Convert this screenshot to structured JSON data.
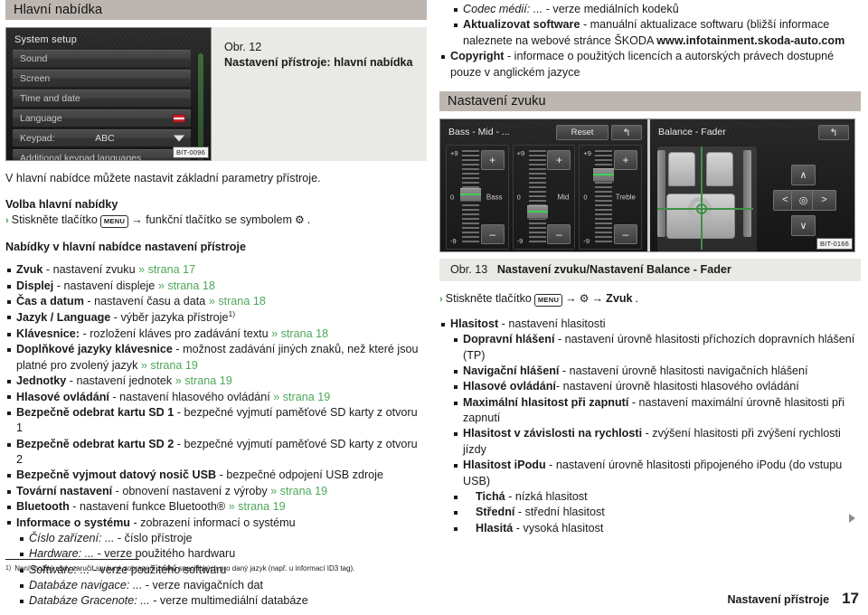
{
  "sections": {
    "main_menu_title": "Hlavní nabídka",
    "sound_settings_title": "Nastavení zvuku"
  },
  "figure_12": {
    "number": "Obr. 12",
    "title": "Nastavení přístroje: hlavní nabídka",
    "bit_tag": "BIT-0096",
    "screen": {
      "header": "System setup",
      "rows": [
        {
          "label": "Sound",
          "value": "",
          "icon": ""
        },
        {
          "label": "Screen",
          "value": "",
          "icon": ""
        },
        {
          "label": "Time and date",
          "value": "",
          "icon": ""
        },
        {
          "label": "Language",
          "value": "",
          "icon": "flag-icon"
        },
        {
          "label": "Keypad:",
          "value": "ABC",
          "icon": "chevron-down-icon"
        },
        {
          "label": "Additional keypad languages",
          "value": "",
          "icon": ""
        }
      ]
    }
  },
  "figure_13": {
    "number": "Obr. 13",
    "title": "Nastavení zvuku/Nastavení Balance - Fader",
    "bit_tag": "BIT-0166",
    "equalizer": {
      "title": "Bass - Mid - ...",
      "reset_label": "Reset",
      "back_icon": "↰",
      "bands": [
        {
          "name": "Bass",
          "max": "+9",
          "mid": "0",
          "min": "-9",
          "plus": "+",
          "minus": "–",
          "knob_pct": 41
        },
        {
          "name": "Mid",
          "max": "+9",
          "mid": "0",
          "min": "-9",
          "plus": "+",
          "minus": "–",
          "knob_pct": 58
        },
        {
          "name": "Treble",
          "max": "+9",
          "mid": "0",
          "min": "-9",
          "plus": "+",
          "minus": "–",
          "knob_pct": 22
        }
      ]
    },
    "balance_fader": {
      "title": "Balance - Fader",
      "back_icon": "↰",
      "buttons": {
        "up": "∧",
        "down": "∨",
        "left": "<",
        "right": ">",
        "center": "◎"
      }
    }
  },
  "left_column": {
    "intro": "V hlavní nabídce můžete nastavit základní parametry přístroje.",
    "select_heading": "Volba hlavní nabídky",
    "step": {
      "arrow": "›",
      "before_key": "Stiskněte tlačítko",
      "menu_key": "MENU",
      "after_key": "→ funkční tlačítko se symbolem",
      "gear": "⚙",
      "end": "."
    },
    "menus_heading": "Nabídky v hlavní nabídce nastavení přístroje",
    "items": [
      {
        "level": 1,
        "bold": "Zvuk",
        "text": " - nastavení zvuku ",
        "ref": "» strana 17"
      },
      {
        "level": 1,
        "bold": "Displej",
        "text": " - nastavení displeje ",
        "ref": "» strana 18"
      },
      {
        "level": 1,
        "bold": "Čas a datum",
        "text": " - nastavení času a data ",
        "ref": "» strana 18"
      },
      {
        "level": 1,
        "bold": "Jazyk / Language",
        "text": " - výběr jazyka přístroje",
        "ref": "",
        "sup": "1)"
      },
      {
        "level": 1,
        "bold": "Klávesnice:",
        "text": " - rozložení kláves pro zadávání textu ",
        "ref": "» strana 18"
      },
      {
        "level": 1,
        "bold": "Doplňkové jazyky klávesnice",
        "text": " - možnost zadávání jiných znaků, než které jsou platné pro zvolený jazyk ",
        "ref": "» strana 19"
      },
      {
        "level": 1,
        "bold": "Jednotky",
        "text": " - nastavení jednotek ",
        "ref": "» strana 19"
      },
      {
        "level": 1,
        "bold": "Hlasové ovládání",
        "text": " - nastavení hlasového ovládání ",
        "ref": "» strana 19"
      },
      {
        "level": 1,
        "bold": "Bezpečně odebrat kartu SD 1",
        "text": " - bezpečné vyjmutí paměťové SD karty z otvoru 1",
        "ref": ""
      },
      {
        "level": 1,
        "bold": "Bezpečně odebrat kartu SD 2",
        "text": " - bezpečné vyjmutí paměťové SD karty z otvoru 2",
        "ref": ""
      },
      {
        "level": 1,
        "bold": "Bezpečně vyjmout datový nosič USB",
        "text": " - bezpečné odpojení USB zdroje",
        "ref": ""
      },
      {
        "level": 1,
        "bold": "Tovární nastavení",
        "text": " - obnovení nastavení z výroby ",
        "ref": "» strana 19"
      },
      {
        "level": 1,
        "bold": "Bluetooth",
        "text": " - nastavení funkce Bluetooth® ",
        "ref": "» strana 19"
      },
      {
        "level": 1,
        "bold": "Informace o systému",
        "text": " - zobrazení informací o systému",
        "ref": ""
      },
      {
        "level": 2,
        "italic": "Číslo zařízení: ...",
        "text": " - číslo přístroje",
        "ref": ""
      },
      {
        "level": 2,
        "italic": "Hardware: ...",
        "text": " - verze použitého hardwaru",
        "ref": ""
      },
      {
        "level": 2,
        "italic": "Software: ...",
        "text": " - verze použitého softwaru",
        "ref": ""
      },
      {
        "level": 2,
        "italic": "Databáze navigace: ...",
        "text": " - verze navigačních dat",
        "ref": ""
      },
      {
        "level": 2,
        "italic": "Databáze Gracenote: ...",
        "text": " - verze multimediální databáze",
        "ref": ""
      }
    ],
    "footnote_marker": "1)",
    "footnote_text": "Není možné vždy zaručit správné zobrazení znaků specifických pro daný jazyk (např. u informací ID3 tag)."
  },
  "right_column": {
    "top_items": [
      {
        "level": 2,
        "italic": "Codec médií: ...",
        "text": " - verze mediálních kodeků",
        "ref": ""
      },
      {
        "level": 2,
        "bold": "Aktualizovat software",
        "text": " - manuální aktualizace softwaru (bližší informace naleznete na webové stránce ŠKODA ",
        "strong": "www.infotainment.skoda-auto.com",
        "ref": ""
      },
      {
        "level": 1,
        "bold": "Copyright",
        "text": " - informace o použitých licencích a autorských právech dostupné pouze v anglickém jazyce",
        "ref": ""
      }
    ],
    "step": {
      "arrow": "›",
      "before_key": "Stiskněte tlačítko",
      "menu_key": "MENU",
      "after_key": "→",
      "gear": "⚙",
      "arrow2": "→",
      "bold_end": "Zvuk",
      "end": "."
    },
    "items": [
      {
        "level": 1,
        "bold": "Hlasitost",
        "text": " - nastavení hlasitosti",
        "ref": ""
      },
      {
        "level": 2,
        "bold": "Dopravní hlášení",
        "text": " - nastavení úrovně hlasitosti příchozích dopravních hlášení (TP)",
        "ref": ""
      },
      {
        "level": 2,
        "bold": "Navigační hlášení",
        "text": " - nastavení úrovně hlasitosti navigačních hlášení",
        "ref": ""
      },
      {
        "level": 2,
        "bold": "Hlasové ovládání",
        "text": "- nastavení úrovně hlasitosti hlasového ovládání",
        "ref": ""
      },
      {
        "level": 2,
        "bold": "Maximální hlasitost při zapnutí",
        "text": " - nastavení maximální úrovně hlasitosti při zapnutí",
        "ref": ""
      },
      {
        "level": 2,
        "bold": "Hlasitost v závislosti na rychlosti",
        "text": " - zvýšení hlasitosti při zvýšení rychlosti jízdy",
        "ref": ""
      },
      {
        "level": 2,
        "bold": "Hlasitost iPodu",
        "text": " - nastavení úrovně hlasitosti připojeného iPodu (do vstupu USB)",
        "ref": ""
      },
      {
        "level": 3,
        "bold": "Tichá",
        "text": " - nízká hlasitost",
        "ref": ""
      },
      {
        "level": 3,
        "bold": "Střední",
        "text": " - střední hlasitost",
        "ref": ""
      },
      {
        "level": 3,
        "bold": "Hlasitá",
        "text": " - vysoká hlasitost",
        "ref": ""
      }
    ]
  },
  "footer": {
    "title": "Nastavení přístroje",
    "page_number": "17"
  },
  "colors": {
    "section_bar": "#bdb6b0",
    "caption_bg": "#e9e9e6",
    "link_green": "#4fa85a",
    "accent_green": "#3ecf58"
  }
}
